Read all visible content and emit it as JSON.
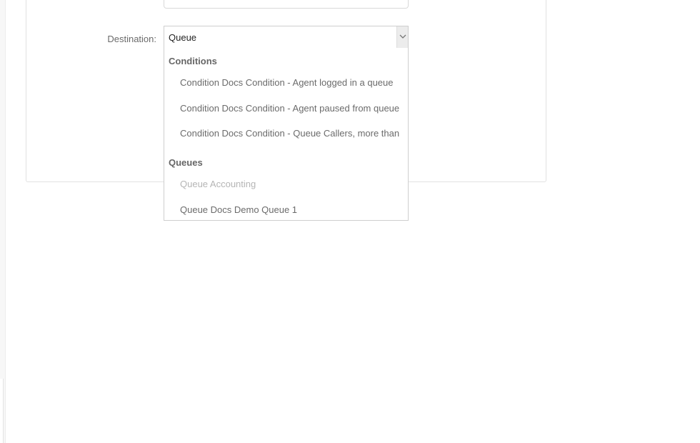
{
  "form": {
    "destination_label": "Destination:",
    "destination_value": "Queue"
  },
  "dropdown": {
    "groups": [
      {
        "label": "Conditions",
        "options": [
          {
            "label": "Condition Docs Condition - Agent logged in a queue",
            "disabled": false
          },
          {
            "label": "Condition Docs Condition - Agent paused from queue",
            "disabled": false
          },
          {
            "label": "Condition Docs Condition - Queue Callers, more than",
            "disabled": false
          }
        ]
      },
      {
        "label": "Queues",
        "options": [
          {
            "label": "Queue Accounting",
            "disabled": true
          },
          {
            "label": "Queue Docs Demo Queue 1",
            "disabled": false
          }
        ]
      }
    ]
  },
  "icons": {
    "select_arrow": "chevron-down-icon"
  },
  "colors": {
    "text": "#555555",
    "disabled_text": "#b5b5b5",
    "border": "#cfcfcf"
  }
}
